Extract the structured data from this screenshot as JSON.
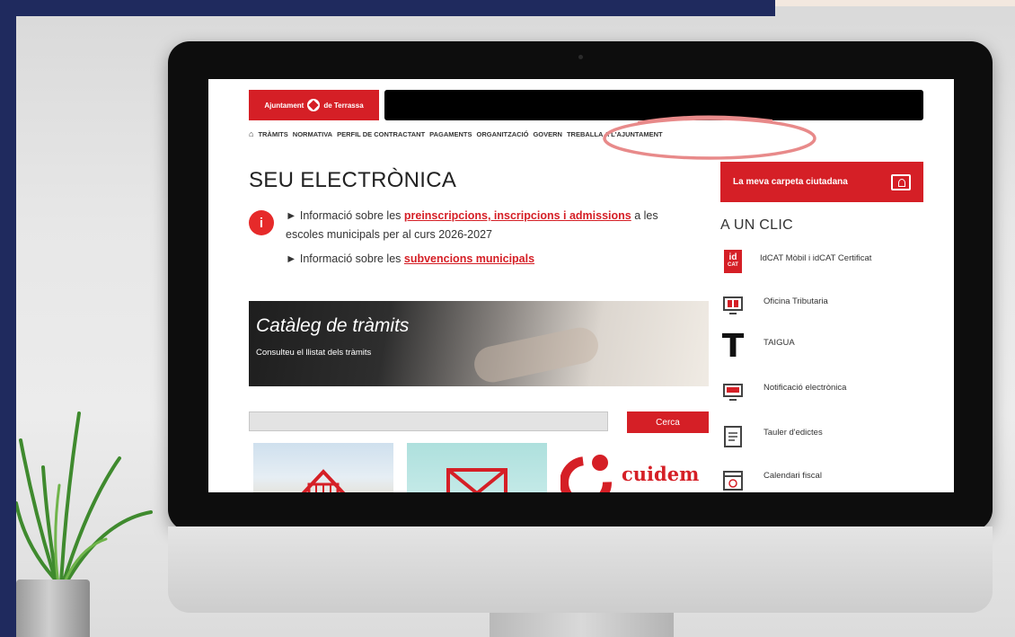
{
  "site": {
    "logo_text_left": "Ajuntament",
    "logo_text_right": "de Terrassa"
  },
  "nav": {
    "items": [
      "TRÀMITS",
      "NORMATIVA",
      "PERFIL DE CONTRACTANT",
      "PAGAMENTS",
      "ORGANITZACIÓ",
      "GOVERN",
      "TREBALLA A L'AJUNTAMENT"
    ]
  },
  "page": {
    "title": "SEU ELECTRÒNICA"
  },
  "info": {
    "line1_prefix": "► Informació sobre les ",
    "line1_link": "preinscripcions, inscripcions i admissions",
    "line1_suffix": " a les escoles municipals per al curs 2026-2027",
    "line2_prefix": "► Informació sobre les ",
    "line2_link": "subvencions municipals"
  },
  "banner": {
    "title": "Catàleg de tràmits",
    "subtitle": "Consulteu el llistat dels tràmits"
  },
  "search": {
    "placeholder": "",
    "button": "Cerca"
  },
  "tiles": {
    "cuidem": "cuidem"
  },
  "sidebar": {
    "carpeta": "La meva carpeta ciutadana",
    "clic_title": "A UN CLIC",
    "idcat_icon": "id\nCAT",
    "items": [
      {
        "label": "IdCAT Mòbil i idCAT Certificat",
        "icon": "idcat-icon"
      },
      {
        "label": "Oficina Tributaria",
        "icon": "tax-office-icon"
      },
      {
        "label": "TAIGUA",
        "icon": "taigua-icon"
      },
      {
        "label": "Notificació electrònica",
        "icon": "notification-icon"
      },
      {
        "label": "Tauler d'edictes",
        "icon": "edicts-board-icon"
      },
      {
        "label": "Calendari fiscal",
        "icon": "calendar-icon"
      }
    ]
  },
  "colors": {
    "brand_red": "#d51f26",
    "backdrop_navy": "#1f2a5e",
    "highlight_pink": "#e88a8a"
  }
}
